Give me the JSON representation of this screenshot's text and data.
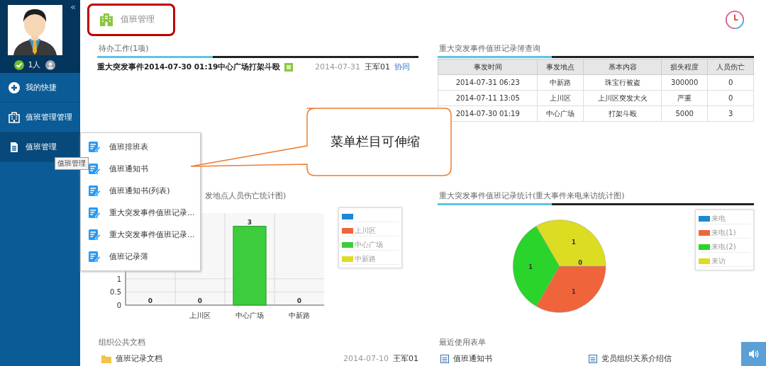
{
  "sidebar": {
    "collapse": "«",
    "user_count": "1人",
    "items": [
      {
        "label": "我的快捷",
        "selected": false
      },
      {
        "label": "值班管理管理",
        "selected": false
      },
      {
        "label": "值班管理",
        "selected": true
      }
    ],
    "tooltip": "值班管理"
  },
  "header": {
    "tab": "值班管理"
  },
  "popup_menu": [
    "值班排班表",
    "值班通知书",
    "值班通知书(列表)",
    "重大突发事件值班记录...",
    "重大突发事件值班记录...",
    "值班记录薄"
  ],
  "callout": "菜单栏目可伸缩",
  "pending": {
    "title": "待办工作(1项)",
    "rows": [
      {
        "subject": "重大突发事件2014-07-30 01:19中心广场打架斗殴",
        "date": "2014-07-31",
        "user": "王军01",
        "action": "协同"
      }
    ]
  },
  "query": {
    "title": "重大突发事件值班记录簿查询",
    "columns": [
      "事发时间",
      "事发地点",
      "基本内容",
      "损失程度",
      "人员伤亡"
    ],
    "rows": [
      [
        "2014-07-31 06:23",
        "中新路",
        "珠宝行被盗",
        "300000",
        "0"
      ],
      [
        "2014-07-11 13:05",
        "上川区",
        "上川区突发大火",
        "严重",
        "0"
      ],
      [
        "2014-07-30 01:19",
        "中心广场",
        "打架斗殴",
        "5000",
        "3"
      ]
    ]
  },
  "bar_panel": {
    "title": "发地点人员伤亡统计图)",
    "chart_data": {
      "type": "bar",
      "categories": [
        null,
        "上川区",
        "中心广场",
        "中新路"
      ],
      "stacked": true,
      "data_labels": true,
      "ylim": [
        0,
        3.5
      ],
      "yticks": [
        0,
        0.5,
        1
      ],
      "series": [
        {
          "color": "#1e88d4",
          "values": [
            0,
            null,
            null,
            null
          ]
        },
        {
          "name": "上川区",
          "color": "#f0643c",
          "values": [
            null,
            0,
            null,
            null
          ]
        },
        {
          "name": "中心广场",
          "color": "#3ccc3c",
          "values": [
            null,
            null,
            3,
            null
          ]
        },
        {
          "name": "中新路",
          "color": "#dcdc22",
          "values": [
            null,
            null,
            null,
            0
          ]
        }
      ]
    }
  },
  "pie_panel": {
    "title": "重大突发事件值班记录统计(重大事件来电来访统计图)",
    "chart_data": {
      "type": "pie",
      "categories": [
        "来电",
        "来电(1)",
        "来电(2)",
        "来访"
      ],
      "colors": [
        "#1e88d4",
        "#f0643c",
        "#2ad42a",
        "#dcdc22"
      ],
      "values": [
        0,
        1,
        1,
        1
      ],
      "value_labels": [
        "0",
        "1",
        "1",
        "1"
      ]
    }
  },
  "documents": {
    "title": "组织公共文档",
    "rows": [
      {
        "name": "值班记录文档",
        "date": "2014-07-10",
        "user": "王军01"
      }
    ]
  },
  "recent_forms": {
    "title": "最近使用表单",
    "items": [
      "值班通知书",
      "党员组织关系介绍信"
    ]
  }
}
